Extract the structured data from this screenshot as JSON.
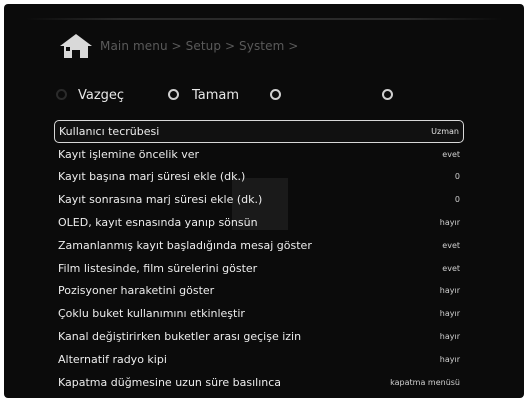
{
  "breadcrumb": "Main menu > Setup > System >",
  "buttons": [
    {
      "label": "Vazgeç"
    },
    {
      "label": "Tamam"
    }
  ],
  "menu": [
    {
      "label": "Kullanıcı tecrübesi",
      "value": "Uzman"
    },
    {
      "label": "Kayıt işlemine öncelik ver",
      "value": "evet"
    },
    {
      "label": "Kayıt başına marj süresi ekle (dk.)",
      "value": "0"
    },
    {
      "label": "Kayıt sonrasına marj süresi ekle (dk.)",
      "value": "0"
    },
    {
      "label": "OLED, kayıt esnasında yanıp sönsün",
      "value": "hayır"
    },
    {
      "label": "Zamanlanmış kayıt başladığında mesaj göster",
      "value": "evet"
    },
    {
      "label": "Film listesinde, film sürelerini göster",
      "value": "evet"
    },
    {
      "label": "Pozisyoner haraketini göster",
      "value": "hayır"
    },
    {
      "label": "Çoklu buket kullanımını etkinleştir",
      "value": "hayır"
    },
    {
      "label": "Kanal değiştirirken buketler arası geçişe izin",
      "value": "hayır"
    },
    {
      "label": "Alternatif radyo kipi",
      "value": "hayır"
    },
    {
      "label": "Kapatma düğmesine uzun süre basılınca",
      "value": "kapatma menüsü"
    }
  ],
  "colors": {
    "background": "#0b0b0b",
    "text": "#ededed",
    "breadcrumb": "#5a5a5a",
    "selection_border": "#d8d8d8",
    "button_red": "#2b2b2b",
    "button_green": "#cfcfcf"
  }
}
